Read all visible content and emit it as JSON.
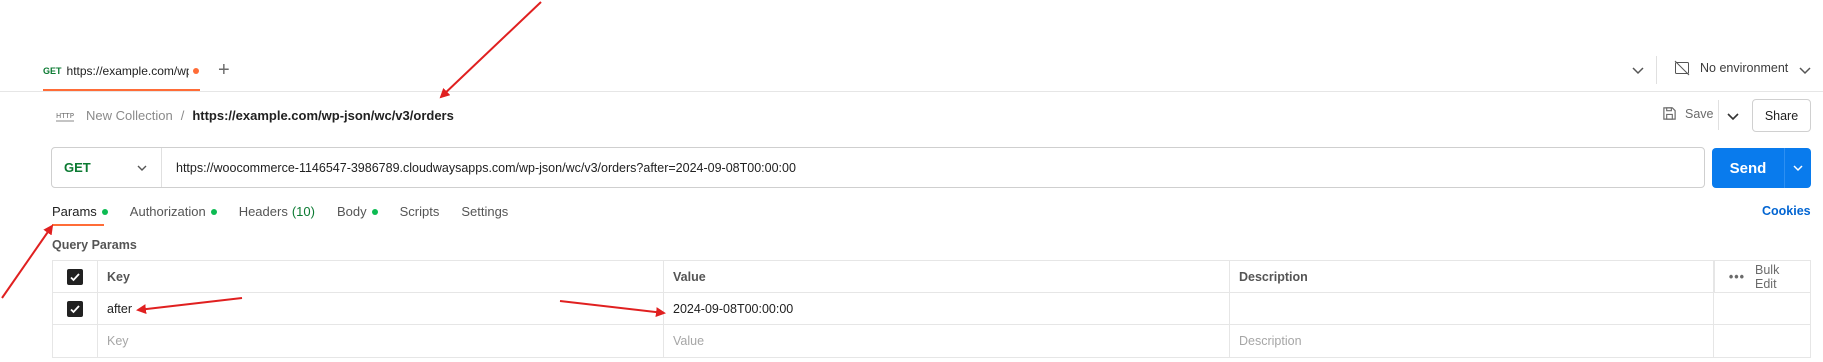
{
  "tab": {
    "method": "GET",
    "url": "https://example.com/wp"
  },
  "environment": {
    "label": "No environment"
  },
  "breadcrumb": {
    "collection": "New Collection",
    "separator": "/",
    "request": "https://example.com/wp-json/wc/v3/orders",
    "icon_text": "HTTP"
  },
  "actions": {
    "save": "Save",
    "share": "Share"
  },
  "request": {
    "method": "GET",
    "url": "https://woocommerce-1146547-3986789.cloudwaysapps.com/wp-json/wc/v3/orders?after=2024-09-08T00:00:00",
    "send": "Send"
  },
  "request_tabs": {
    "params": "Params",
    "authorization": "Authorization",
    "headers": "Headers",
    "headers_count": "(10)",
    "body": "Body",
    "scripts": "Scripts",
    "settings": "Settings",
    "cookies": "Cookies"
  },
  "query_params": {
    "title": "Query Params",
    "columns": {
      "key": "Key",
      "value": "Value",
      "description": "Description",
      "bulk_edit": "Bulk Edit"
    },
    "row": {
      "key": "after",
      "value": "2024-09-08T00:00:00",
      "description": "",
      "checked": true
    },
    "placeholders": {
      "key": "Key",
      "value": "Value",
      "description": "Description"
    }
  },
  "colors": {
    "accent": "#ff6c37",
    "send": "#097bed",
    "method": "#0b7a32",
    "dot": "#0cbb52",
    "link": "#0265d2",
    "annotation_arrow": "#e02020"
  }
}
